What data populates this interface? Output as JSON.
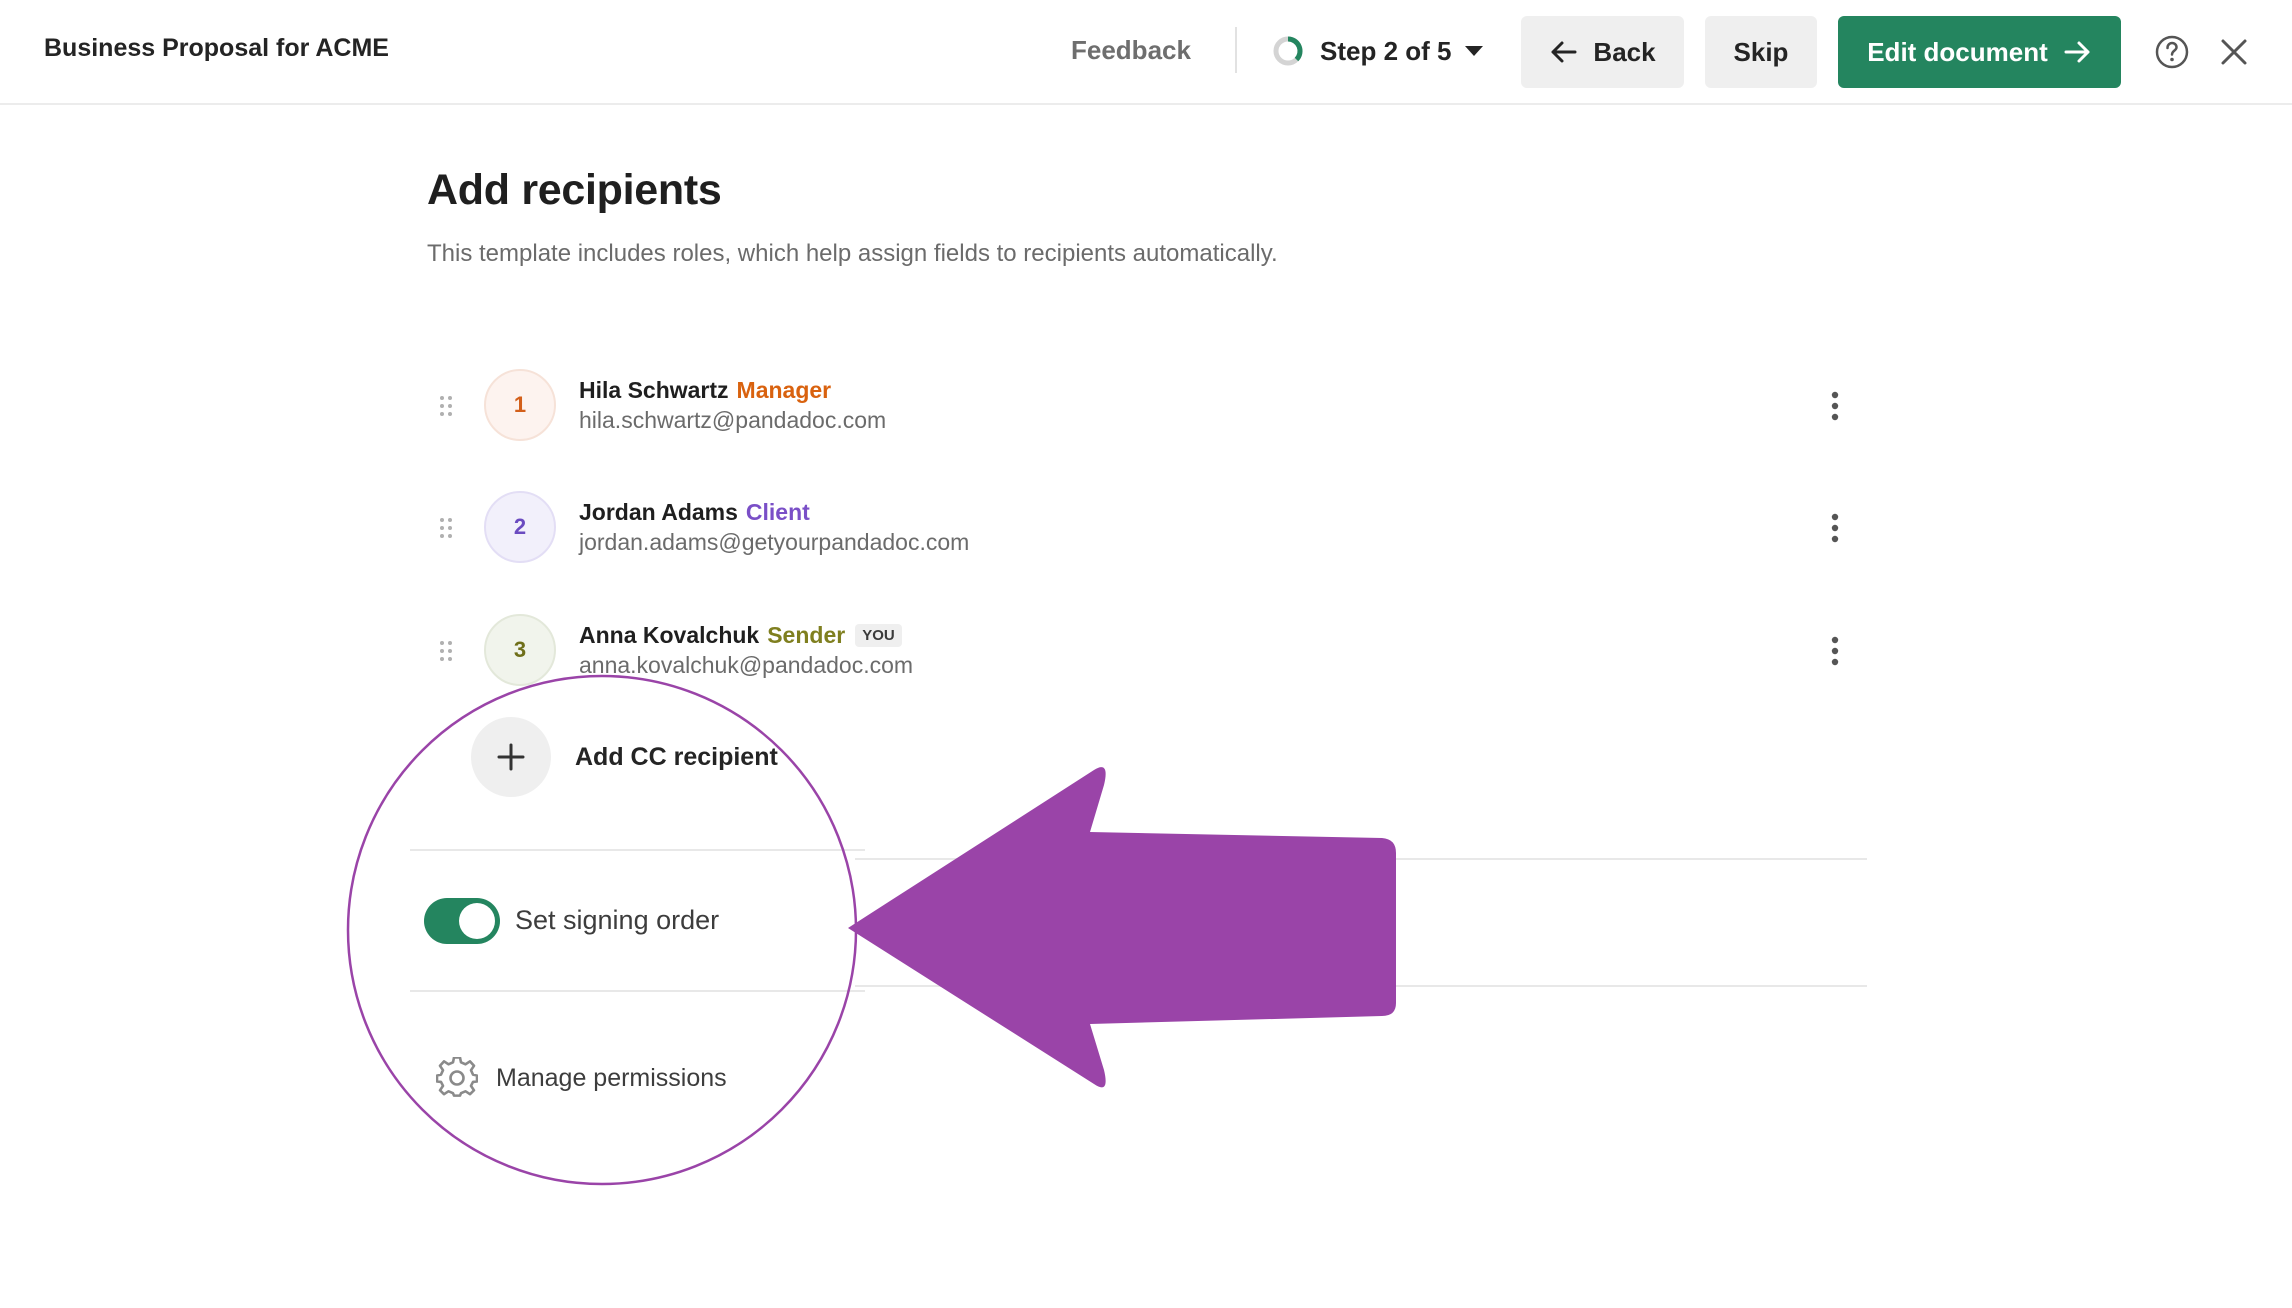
{
  "header": {
    "document_title": "Business Proposal for ACME",
    "feedback_label": "Feedback",
    "step_label": "Step 2 of 5",
    "back_label": "Back",
    "skip_label": "Skip",
    "edit_label": "Edit document"
  },
  "main": {
    "title": "Add recipients",
    "subtitle": "This template includes roles, which help assign fields to recipients automatically.",
    "recipients": [
      {
        "number": "1",
        "name": "Hila Schwartz",
        "role": "Manager",
        "email": "hila.schwartz@pandadoc.com",
        "role_color": "#d9620f",
        "avatar_bg": "#fdf3ef",
        "avatar_fg": "#d35f1a"
      },
      {
        "number": "2",
        "name": "Jordan Adams",
        "role": "Client",
        "email": "jordan.adams@getyourpandadoc.com",
        "role_color": "#7a4fc7",
        "avatar_bg": "#f2f0fb",
        "avatar_fg": "#6b4bc0"
      },
      {
        "number": "3",
        "name": "Anna Kovalchuk",
        "role": "Sender",
        "email": "anna.kovalchuk@pandadoc.com",
        "role_color": "#7f7f1f",
        "avatar_bg": "#f1f4ec",
        "avatar_fg": "#6f6f1a",
        "badge": "YOU"
      }
    ],
    "add_cc_label": "Add CC recipient",
    "signing_order_label": "Set signing order",
    "signing_order_enabled": true,
    "manage_permissions_label": "Manage permissions"
  },
  "icons": {
    "step_progress": "progress-ring-icon",
    "back": "arrow-left-icon",
    "edit": "arrow-right-icon",
    "help": "question-circle-icon",
    "close": "close-icon",
    "drag": "drag-handle-icon",
    "menu": "kebab-menu-icon",
    "add": "plus-icon",
    "permissions": "gear-icon"
  },
  "colors": {
    "primary": "#24855f",
    "annotation": "#9a44a8"
  }
}
